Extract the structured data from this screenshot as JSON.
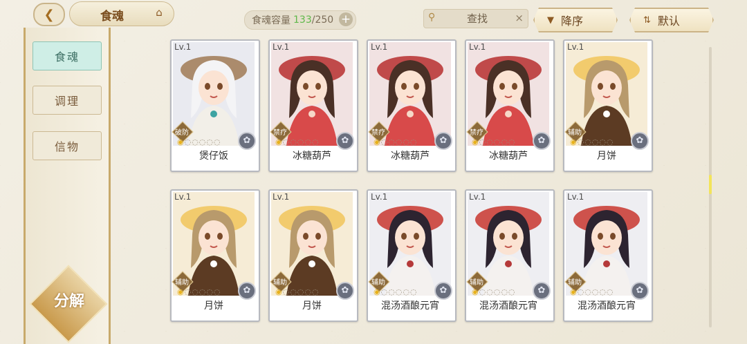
{
  "header": {
    "title": "食魂",
    "back_icon": "back-arrow-icon",
    "home_icon": "home-icon",
    "capacity_label": "食魂容量",
    "capacity_current": "133",
    "capacity_max": "/250",
    "add_label": "+",
    "search_placeholder": "查找",
    "clear_label": "×",
    "sort_order_label": "降序",
    "sort_mode_label": "默认"
  },
  "sidebar": {
    "items": [
      {
        "label": "食魂",
        "active": true
      },
      {
        "label": "调理",
        "active": false
      },
      {
        "label": "信物",
        "active": false
      }
    ],
    "decompose_label": "分解"
  },
  "cards": [
    {
      "level": "Lv.1",
      "role": "破防",
      "name": "煲仔饭",
      "theme": "white-hat"
    },
    {
      "level": "Lv.1",
      "role": "禁疗",
      "name": "冰糖葫芦",
      "theme": "red"
    },
    {
      "level": "Lv.1",
      "role": "禁疗",
      "name": "冰糖葫芦",
      "theme": "red"
    },
    {
      "level": "Lv.1",
      "role": "禁疗",
      "name": "冰糖葫芦",
      "theme": "red"
    },
    {
      "level": "Lv.1",
      "role": "辅助",
      "name": "月饼",
      "theme": "gold"
    },
    {
      "level": "Lv.1",
      "role": "辅助",
      "name": "月饼",
      "theme": "gold"
    },
    {
      "level": "Lv.1",
      "role": "辅助",
      "name": "月饼",
      "theme": "gold"
    },
    {
      "level": "Lv.1",
      "role": "辅助",
      "name": "混汤酒酿元宵",
      "theme": "dark"
    },
    {
      "level": "Lv.1",
      "role": "辅助",
      "name": "混汤酒酿元宵",
      "theme": "dark"
    },
    {
      "level": "Lv.1",
      "role": "辅助",
      "name": "混汤酒酿元宵",
      "theme": "dark"
    }
  ],
  "colors": {
    "accent_gold": "#c8a96b",
    "active_tab": "#cfeee6",
    "capacity_green": "#5fb84a"
  }
}
